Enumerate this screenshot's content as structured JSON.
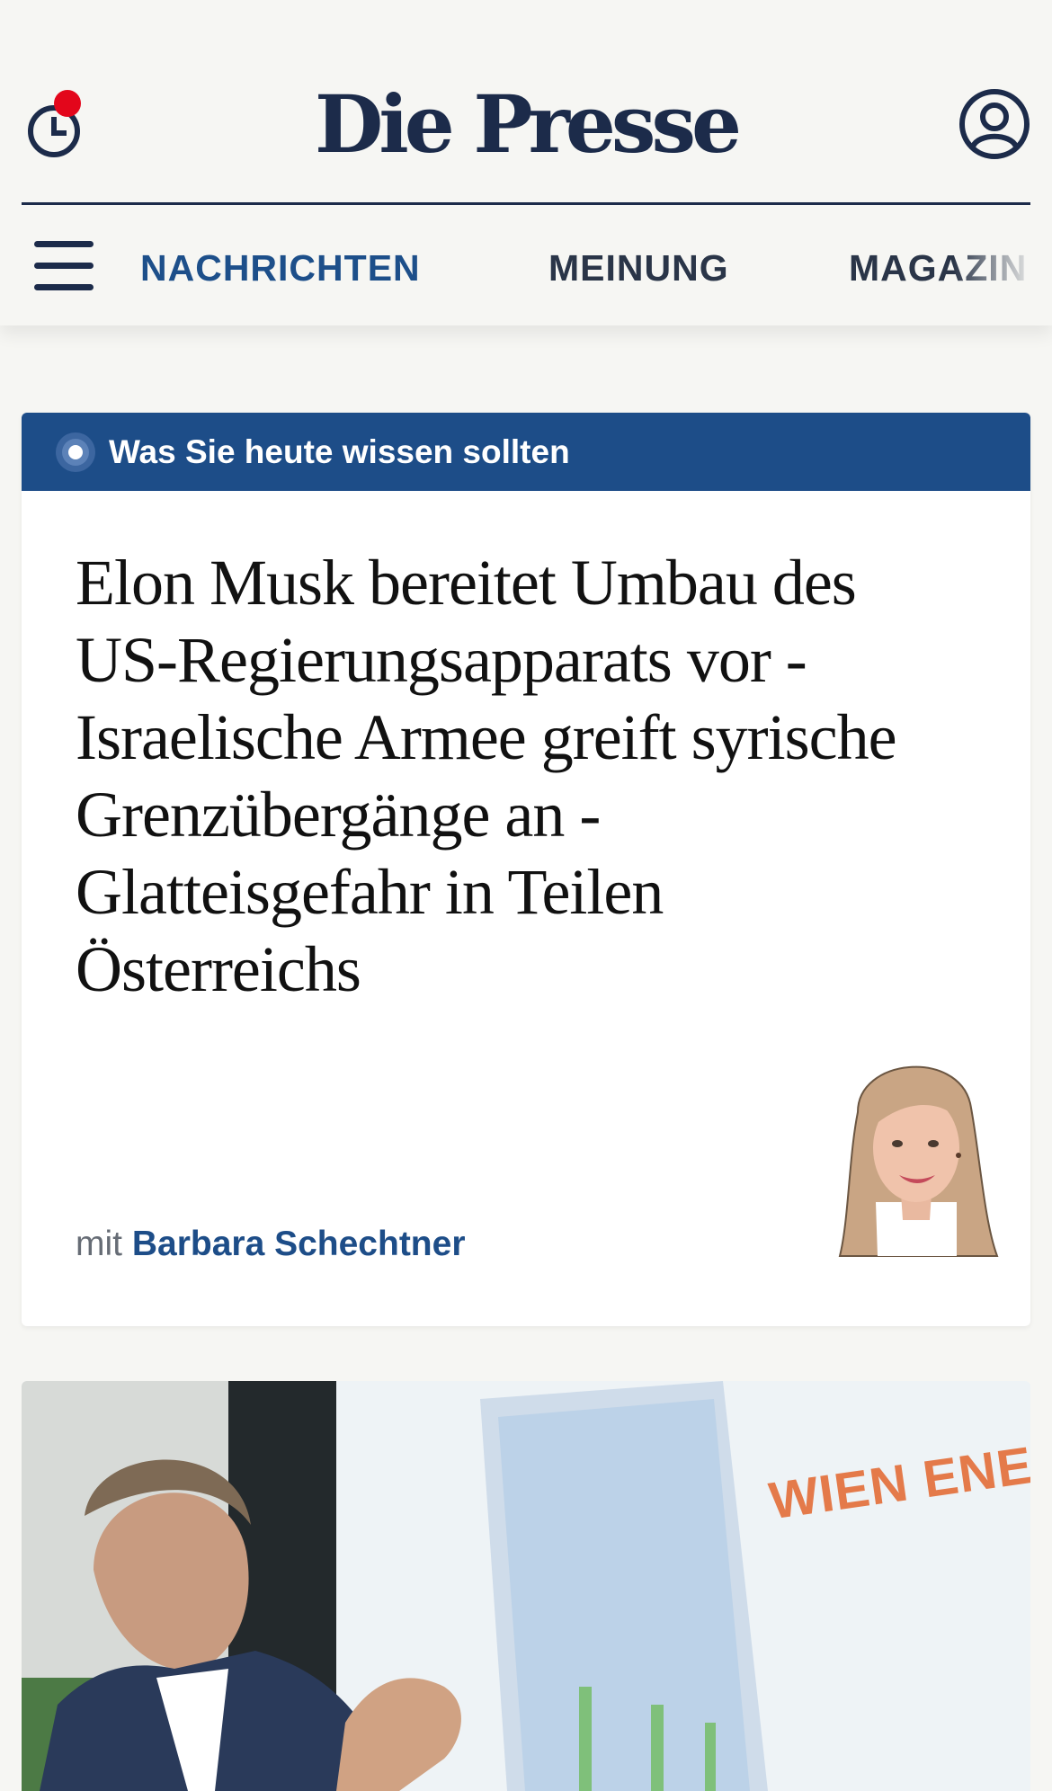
{
  "header": {
    "logo": "Die Presse",
    "history_icon": "history-clock-icon",
    "account_icon": "user-account-icon",
    "notification_color": "#e3061b"
  },
  "nav": {
    "menu_icon": "hamburger-menu-icon",
    "items": [
      {
        "label": "NACHRICHTEN",
        "active": true
      },
      {
        "label": "MEINUNG",
        "active": false
      },
      {
        "label": "MAGAZIN",
        "active": false
      }
    ]
  },
  "briefing": {
    "label": "Was Sie heute wissen sollten",
    "headline": "Elon Musk bereitet Umbau des US-Regierungsapparats vor - Israelische Armee greift syrische Grenzübergänge an - Glatteisgefahr in Teilen Österreichs",
    "byline_prefix": "mit",
    "author": "Barbara Schechtner"
  },
  "article_image": {
    "sign_text": "WIEN ENERGIE"
  },
  "colors": {
    "brand_navy": "#1c2b4a",
    "accent_blue": "#1d4d88",
    "background": "#f6f6f3"
  }
}
